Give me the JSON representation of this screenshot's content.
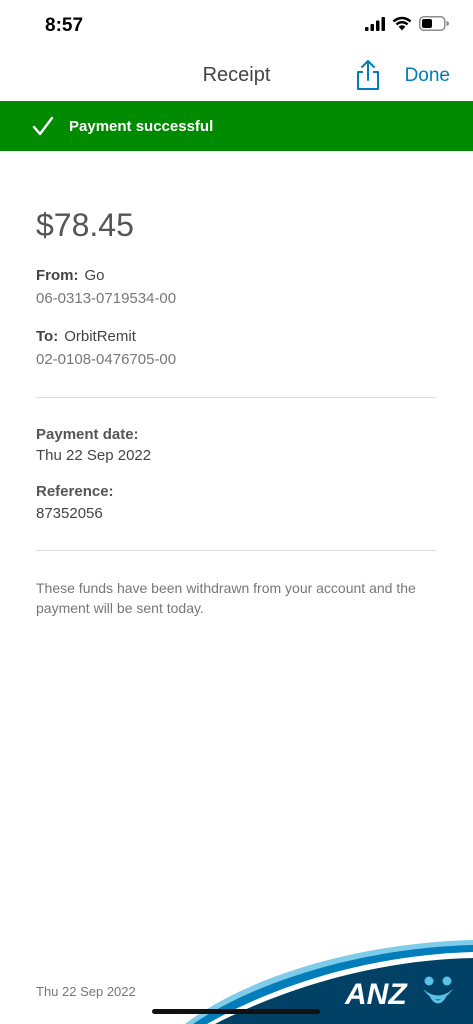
{
  "status_bar": {
    "time": "8:57"
  },
  "nav": {
    "title": "Receipt",
    "done_label": "Done"
  },
  "banner": {
    "text": "Payment successful",
    "color": "#008a00"
  },
  "receipt": {
    "amount": "$78.45",
    "from_label": "From:",
    "from_name": "Go",
    "from_account": "06-0313-0719534-00",
    "to_label": "To:",
    "to_name": "OrbitRemit",
    "to_account": "02-0108-0476705-00",
    "payment_date_label": "Payment date:",
    "payment_date": "Thu 22 Sep 2022",
    "reference_label": "Reference:",
    "reference": "87352056",
    "note": "These funds have been withdrawn from your account and the payment will be sent today."
  },
  "footer": {
    "date": "Thu 22 Sep 2022",
    "brand": "ANZ"
  },
  "colors": {
    "accent": "#007dba",
    "brand_dark": "#004165"
  }
}
